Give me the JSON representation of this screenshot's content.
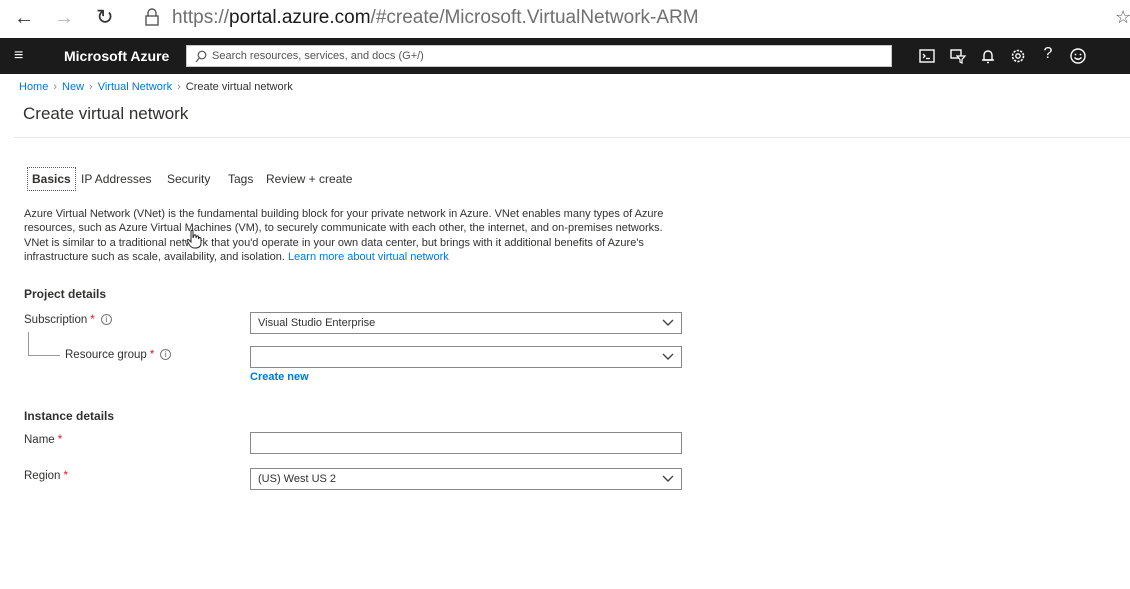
{
  "browser": {
    "url_prefix": "https://",
    "url_domain": "portal.azure.com",
    "url_path": "/#create/Microsoft.VirtualNetwork-ARM"
  },
  "header": {
    "brand": "Microsoft Azure",
    "search_placeholder": "Search resources, services, and docs (G+/)"
  },
  "breadcrumb": {
    "items": [
      "Home",
      "New",
      "Virtual Network"
    ],
    "current": "Create virtual network"
  },
  "page": {
    "title": "Create virtual network"
  },
  "tabs": [
    "Basics",
    "IP Addresses",
    "Security",
    "Tags",
    "Review + create"
  ],
  "description": {
    "text": "Azure Virtual Network (VNet) is the fundamental building block for your private network in Azure. VNet enables many types of Azure resources, such as Azure Virtual Machines (VM), to securely communicate with each other, the internet, and on-premises networks. VNet is similar to a traditional network that you'd operate in your own data center, but brings with it additional benefits of Azure's infrastructure such as scale, availability, and isolation.",
    "link": "Learn more about virtual network"
  },
  "form": {
    "project_heading": "Project details",
    "subscription_label": "Subscription",
    "subscription_value": "Visual Studio Enterprise",
    "resource_group_label": "Resource group",
    "resource_group_value": "",
    "create_new": "Create new",
    "instance_heading": "Instance details",
    "name_label": "Name",
    "name_value": "",
    "region_label": "Region",
    "region_value": "(US) West US 2",
    "required_marker": "*"
  },
  "colors": {
    "accent": "#0078d4",
    "topbar": "#1b1b1b",
    "required": "#e81123"
  }
}
